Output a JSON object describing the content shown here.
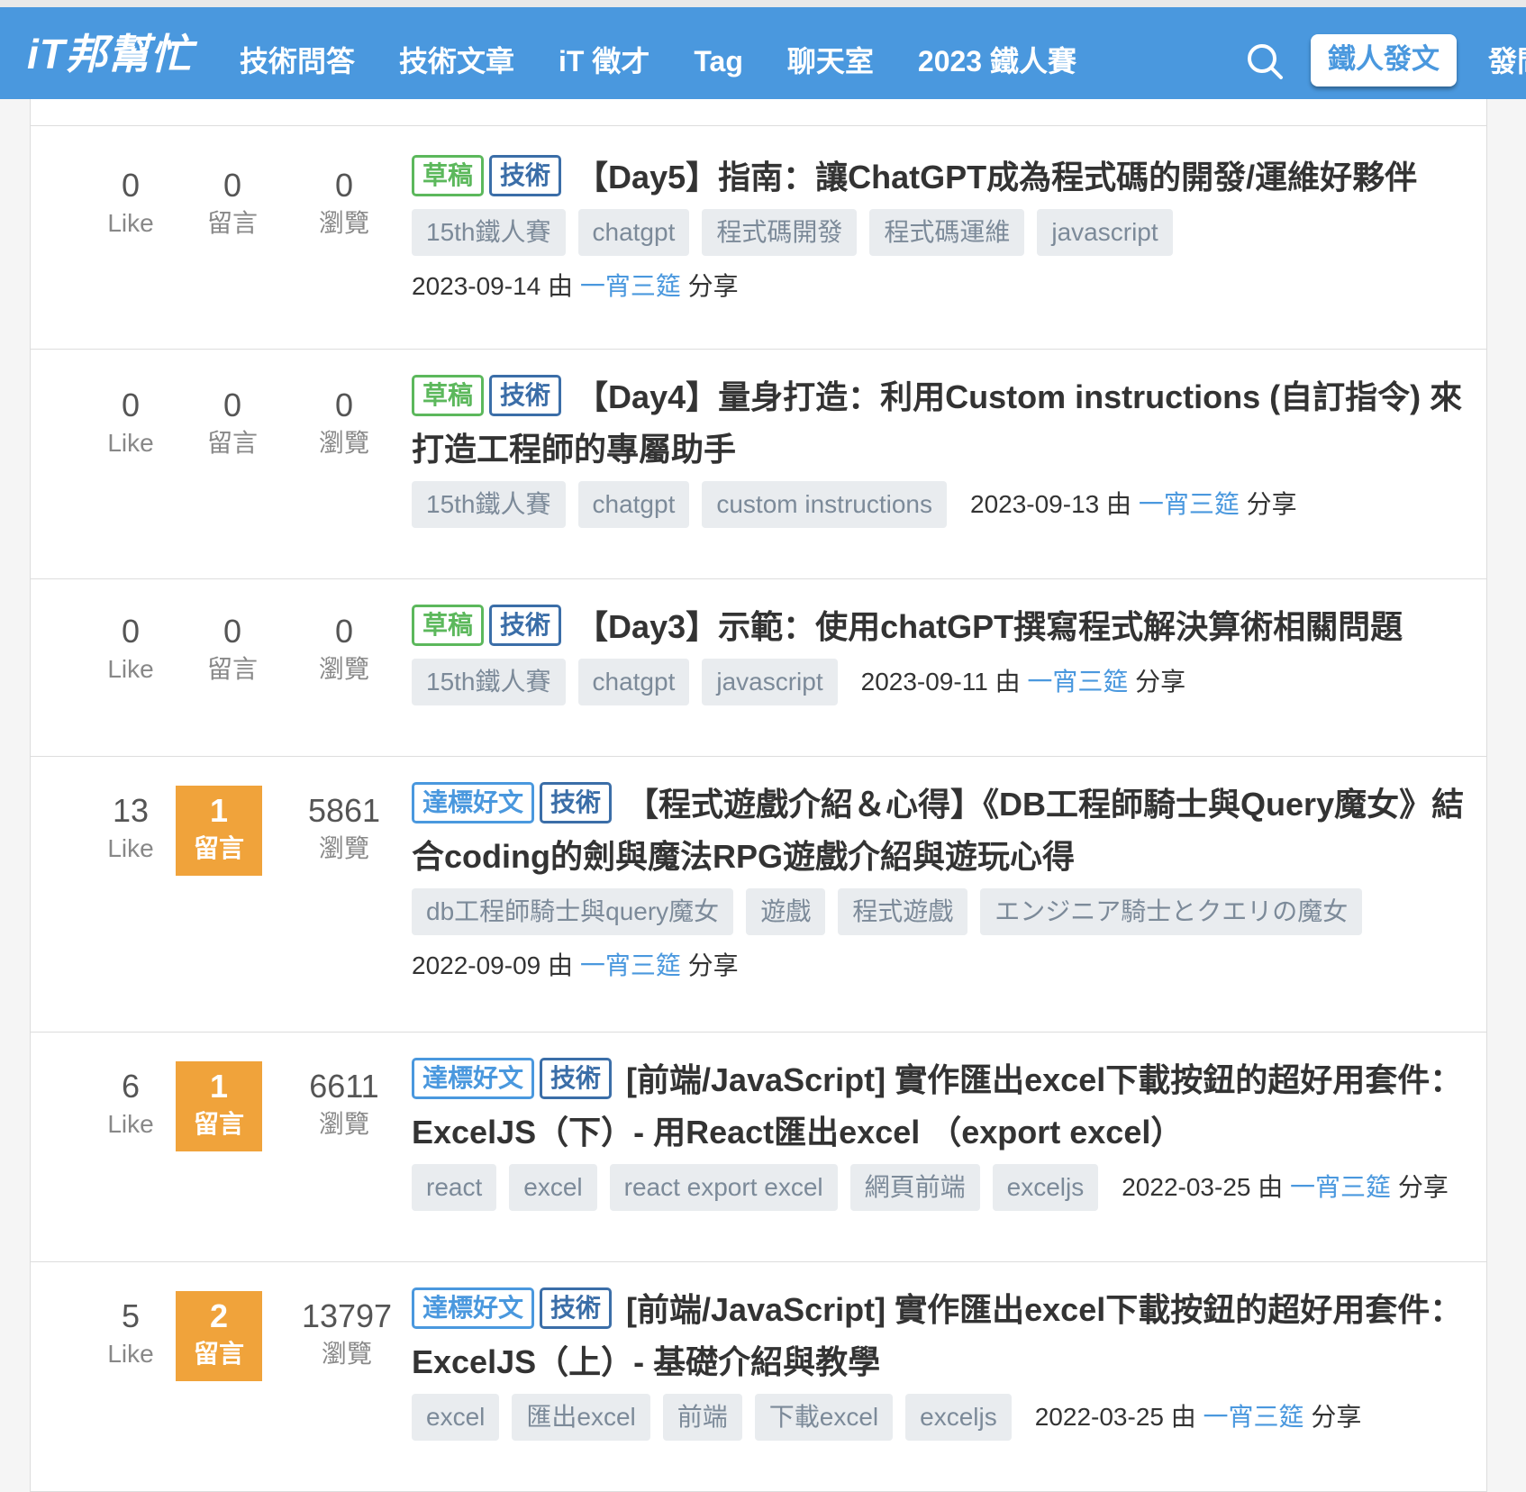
{
  "header": {
    "logo": "iT邦幫忙",
    "nav": [
      "技術問答",
      "技術文章",
      "iT 徵才",
      "Tag",
      "聊天室",
      "2023 鐵人賽"
    ],
    "ironman_button": "鐵人發文",
    "post_button": "發問"
  },
  "colors": {
    "brand": "#4a98de",
    "draft": "#5cb85c",
    "tech": "#3b6ea8",
    "highlight": "#f0a33b"
  },
  "articles": [
    {
      "stats": {
        "likes": "0",
        "like_label": "Like",
        "comments": "0",
        "comment_label": "留言",
        "views": "0",
        "view_label": "瀏覽"
      },
      "badges": [
        "草稿",
        "技術"
      ],
      "title": "【Day5】指南：讓ChatGPT成為程式碼的開發/運維好夥伴",
      "tags": [
        "15th鐵人賽",
        "chatgpt",
        "程式碼開發",
        "程式碼運維",
        "javascript"
      ],
      "date": "2023-09-14",
      "by": "由",
      "author": "一宵三筵",
      "share": "分享"
    },
    {
      "stats": {
        "likes": "0",
        "like_label": "Like",
        "comments": "0",
        "comment_label": "留言",
        "views": "0",
        "view_label": "瀏覽"
      },
      "badges": [
        "草稿",
        "技術"
      ],
      "title": "【Day4】量身打造：利用Custom instructions (自訂指令) 來打造工程師的專屬助手",
      "tags": [
        "15th鐵人賽",
        "chatgpt",
        "custom instructions"
      ],
      "date": "2023-09-13",
      "by": "由",
      "author": "一宵三筵",
      "share": "分享"
    },
    {
      "stats": {
        "likes": "0",
        "like_label": "Like",
        "comments": "0",
        "comment_label": "留言",
        "views": "0",
        "view_label": "瀏覽"
      },
      "badges": [
        "草稿",
        "技術"
      ],
      "title": "【Day3】示範：使用chatGPT撰寫程式解決算術相關問題",
      "tags": [
        "15th鐵人賽",
        "chatgpt",
        "javascript"
      ],
      "date": "2023-09-11",
      "by": "由",
      "author": "一宵三筵",
      "share": "分享"
    },
    {
      "stats": {
        "likes": "13",
        "like_label": "Like",
        "comments": "1",
        "comment_label": "留言",
        "views": "5861",
        "view_label": "瀏覽"
      },
      "badges": [
        "達標好文",
        "技術"
      ],
      "title": "【程式遊戲介紹＆心得】《DB工程師騎士與Query魔女》結合coding的劍與魔法RPG遊戲介紹與遊玩心得",
      "tags": [
        "db工程師騎士與query魔女",
        "遊戲",
        "程式遊戲",
        "エンジニア騎士とクエリの魔女"
      ],
      "date": "2022-09-09",
      "by": "由",
      "author": "一宵三筵",
      "share": "分享"
    },
    {
      "stats": {
        "likes": "6",
        "like_label": "Like",
        "comments": "1",
        "comment_label": "留言",
        "views": "6611",
        "view_label": "瀏覽"
      },
      "badges": [
        "達標好文",
        "技術"
      ],
      "title": "[前端/JavaScript] 實作匯出excel下載按鈕的超好用套件：ExcelJS（下）- 用React匯出excel （export excel）",
      "tags": [
        "react",
        "excel",
        "react export excel",
        "網頁前端",
        "exceljs"
      ],
      "date": "2022-03-25",
      "by": "由",
      "author": "一宵三筵",
      "share": "分享"
    },
    {
      "stats": {
        "likes": "5",
        "like_label": "Like",
        "comments": "2",
        "comment_label": "留言",
        "views": "13797",
        "view_label": "瀏覽"
      },
      "badges": [
        "達標好文",
        "技術"
      ],
      "title": "[前端/JavaScript] 實作匯出excel下載按鈕的超好用套件：ExcelJS（上）- 基礎介紹與教學",
      "tags": [
        "excel",
        "匯出excel",
        "前端",
        "下載excel",
        "exceljs"
      ],
      "date": "2022-03-25",
      "by": "由",
      "author": "一宵三筵",
      "share": "分享"
    }
  ]
}
